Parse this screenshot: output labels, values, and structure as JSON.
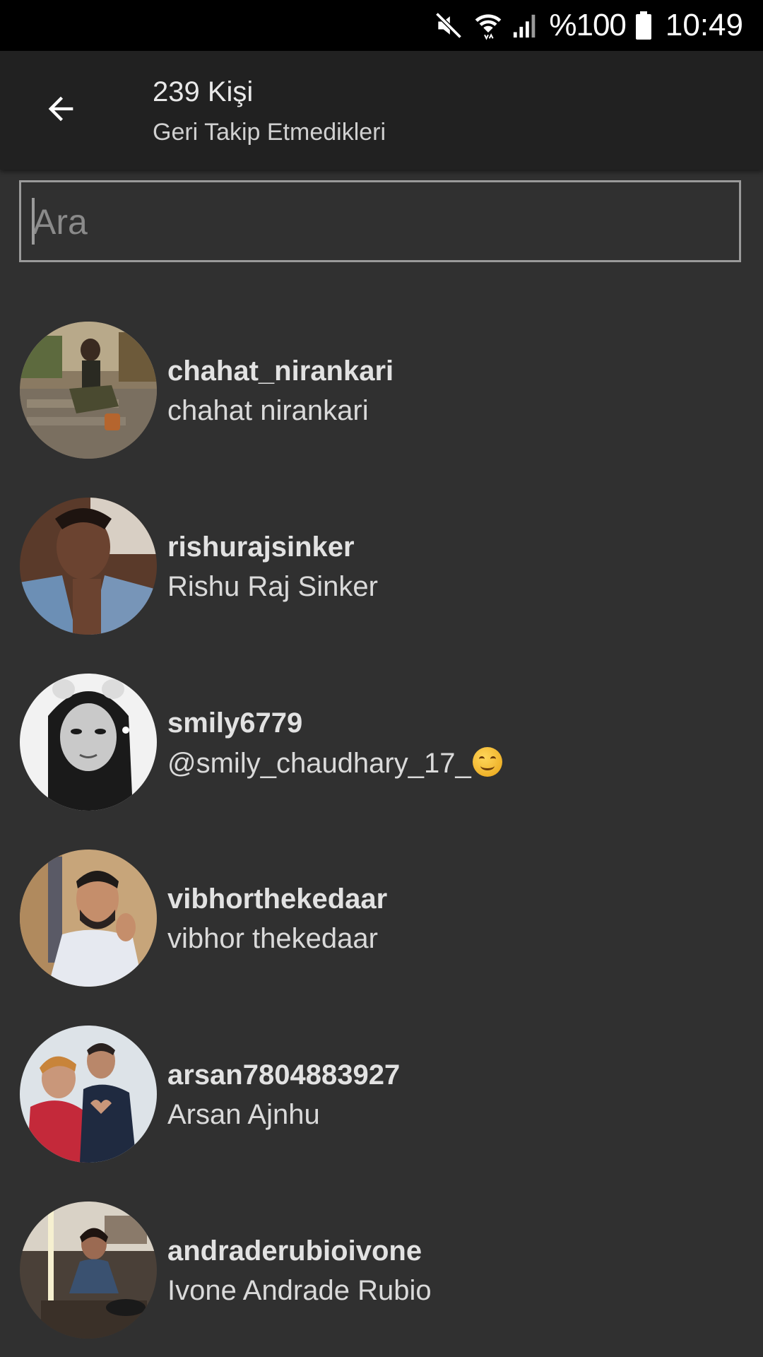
{
  "status_bar": {
    "icons": [
      "mute-icon",
      "wifi-icon",
      "signal-icon",
      "battery-icon"
    ],
    "battery_percent": "%100",
    "time": "10:49"
  },
  "app_bar": {
    "back_icon": "arrow-back-icon",
    "title": "239 Kişi",
    "subtitle": "Geri Takip Etmedikleri"
  },
  "search": {
    "placeholder": "Ara",
    "value": ""
  },
  "list": {
    "items": [
      {
        "username": "chahat_nirankari",
        "full_name": "chahat nirankari"
      },
      {
        "username": "rishurajsinker",
        "full_name": "Rishu Raj Sinker"
      },
      {
        "username": "smily6779",
        "full_name": "@smily_chaudhary_17_",
        "emoji": "smiling-face-emoji"
      },
      {
        "username": "vibhorthekedaar",
        "full_name": "vibhor thekedaar"
      },
      {
        "username": "arsan7804883927",
        "full_name": "Arsan Ajnhu"
      },
      {
        "username": "andraderubioivone",
        "full_name": "Ivone Andrade Rubio"
      }
    ]
  },
  "colors": {
    "background": "#303030",
    "app_bar": "#212121",
    "status_bar": "#000000",
    "text_primary": "#e2e2e2"
  }
}
